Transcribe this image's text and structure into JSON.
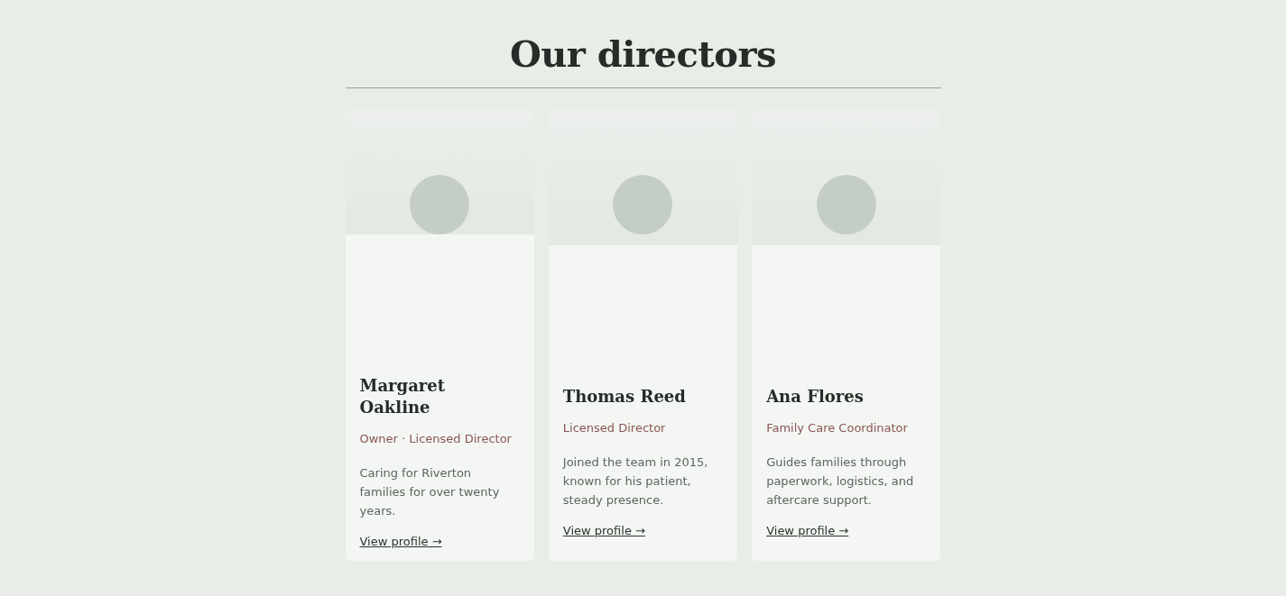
{
  "heading": "Our directors",
  "directors": [
    {
      "name": "Margaret Oakline",
      "role": "Owner · Licensed Director",
      "bio": "Caring for Riverton families for over twenty years.",
      "link": "View profile →"
    },
    {
      "name": "Thomas Reed",
      "role": "Licensed Director",
      "bio": "Joined the team in 2015, known for his patient, steady presence.",
      "link": "View profile →"
    },
    {
      "name": "Ana Flores",
      "role": "Family Care Coordinator",
      "bio": "Guides families through paperwork, logistics, and aftercare support.",
      "link": "View profile →"
    }
  ]
}
